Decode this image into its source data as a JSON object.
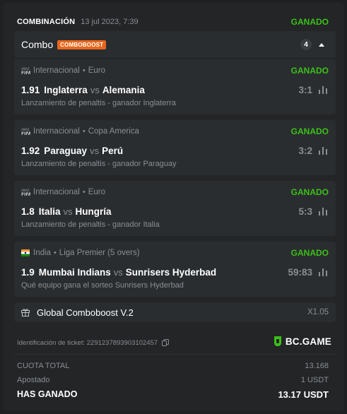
{
  "header": {
    "type": "COMBINACIÓN",
    "date": "13 jul 2023, 7:39",
    "status": "GANADO"
  },
  "combo": {
    "name": "Combo",
    "badge": "COMBOBOOST",
    "count": "4"
  },
  "legs": [
    {
      "icon": "fifa-icon",
      "league": "Internacional",
      "competition": "Euro",
      "status": "GANADO",
      "odds": "1.91",
      "home": "Inglaterra",
      "vs": "vs",
      "away": "Alemania",
      "score": "3:1",
      "market": "Lanzamiento de penaltis - ganador Inglaterra"
    },
    {
      "icon": "fifa-icon",
      "league": "Internacional",
      "competition": "Copa America",
      "status": "GANADO",
      "odds": "1.92",
      "home": "Paraguay",
      "vs": "vs",
      "away": "Perú",
      "score": "3:2",
      "market": "Lanzamiento de penaltis - ganador Paraguay"
    },
    {
      "icon": "fifa-icon",
      "league": "Internacional",
      "competition": "Euro",
      "status": "GANADO",
      "odds": "1.8",
      "home": "Italia",
      "vs": "vs",
      "away": "Hungría",
      "score": "5:3",
      "market": "Lanzamiento de penaltis - ganador Italia"
    },
    {
      "icon": "india-flag-icon",
      "league": "India",
      "competition": "Liga Premier (5 overs)",
      "status": "GANADO",
      "odds": "1.9",
      "home": "Mumbai Indians",
      "vs": "vs",
      "away": "Sunrisers Hyderbad",
      "score": "59:83",
      "market": "Qué equipo gana el sorteo Sunrisers Hyderbad"
    }
  ],
  "boost": {
    "label": "Global Comboboost V.2",
    "multiplier": "X1.05"
  },
  "ticket": {
    "label": "Identificación de ticket: 2291237893903102457"
  },
  "brand": {
    "name": "BC.GAME",
    "color": "#3bc117"
  },
  "summary": {
    "odds_label": "CUOTA TOTAL",
    "odds_value": "13.168",
    "staked_label": "Apostado",
    "staked_value": "1 USDT",
    "won_label": "HAS GANADO",
    "won_value": "13.17 USDT"
  },
  "colors": {
    "win": "#3bc117",
    "boost_badge": "#e8671d",
    "muted": "#8a8e93"
  }
}
